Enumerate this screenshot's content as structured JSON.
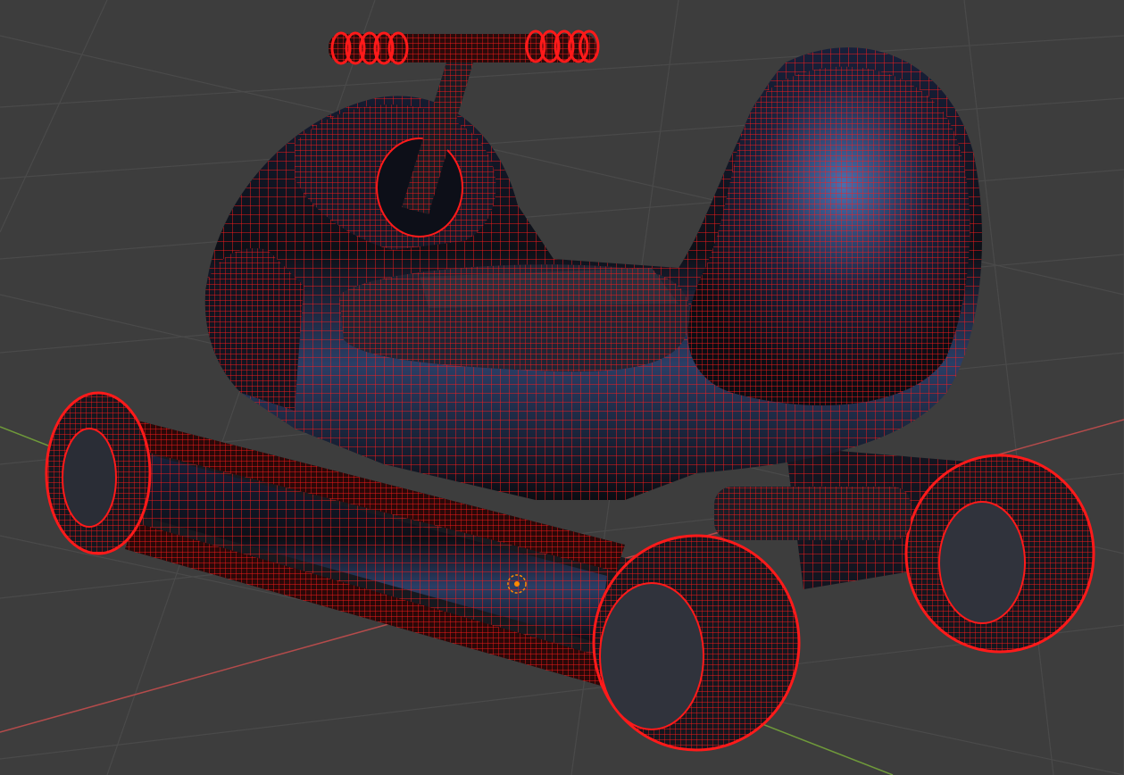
{
  "colors": {
    "background": "#3d3d3d",
    "grid_line": "#4a4a4a",
    "axis_x": "#b44b4b",
    "axis_y": "#6f9a3a",
    "wireframe": "#ff1a1a",
    "body_shade": "#0f1118",
    "highlight": "#8fb4e6",
    "origin_marker": "#ff8a00"
  },
  "viewport": {
    "mode": "wireframe-overlay",
    "object": {
      "icon": "rocking-vehicle-mesh",
      "selected": true
    }
  }
}
